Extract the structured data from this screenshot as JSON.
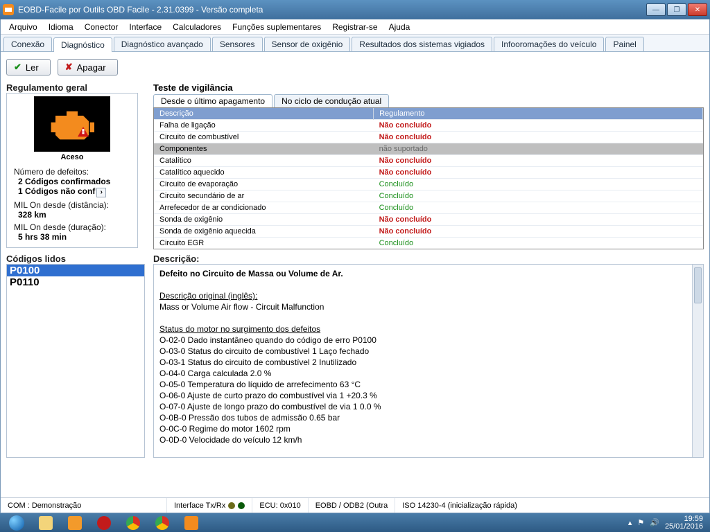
{
  "window": {
    "title": "EOBD-Facile por Outils OBD Facile - 2.31.0399 - Versão completa"
  },
  "menu": {
    "items": [
      "Arquivo",
      "Idioma",
      "Conector",
      "Interface",
      "Calculadores",
      "Funções suplementares",
      "Registrar-se",
      "Ajuda"
    ]
  },
  "tabs": {
    "items": [
      "Conexão",
      "Diagnóstico",
      "Diagnóstico avançado",
      "Sensores",
      "Sensor de oxigênio",
      "Resultados dos sistemas vigiados",
      "Infooromações do veículo",
      "Painel"
    ],
    "active": 1
  },
  "toolbar": {
    "read": "Ler",
    "erase": "Apagar"
  },
  "left": {
    "title": "Regulamento geral",
    "engine_state": "Aceso",
    "defects_label": "Número de defeitos:",
    "confirmed": "2 Códigos confirmados",
    "unconfirmed": "1 Códigos não conf",
    "mil_dist_label": "MIL On desde (distância):",
    "mil_dist": "328 km",
    "mil_dur_label": "MIL On desde (duração):",
    "mil_dur": "5 hrs 38 min"
  },
  "vigil": {
    "title": "Teste de vigilância",
    "tabs": [
      "Desde o último apagamento",
      "No ciclo de condução atual"
    ],
    "active_tab": 0,
    "headers": [
      "Descrição",
      "Regulamento"
    ],
    "rows": [
      {
        "d": "Falha de ligação",
        "s": "Não concluído",
        "c": "red"
      },
      {
        "d": "Circuito de combustível",
        "s": "Não concluído",
        "c": "red"
      },
      {
        "d": "Componentes",
        "s": "não suportado",
        "c": "grey",
        "sel": true
      },
      {
        "d": "Catalítico",
        "s": "Não concluído",
        "c": "red"
      },
      {
        "d": "Catalítico aquecido",
        "s": "Não concluído",
        "c": "red"
      },
      {
        "d": "Circuito de evaporação",
        "s": "Concluído",
        "c": "green"
      },
      {
        "d": "Circuito secundário de ar",
        "s": "Concluído",
        "c": "green"
      },
      {
        "d": "Arrefecedor de ar condicionado",
        "s": "Concluído",
        "c": "green"
      },
      {
        "d": "Sonda de oxigênio",
        "s": "Não concluído",
        "c": "red"
      },
      {
        "d": "Sonda de oxigênio aquecida",
        "s": "Não concluído",
        "c": "red"
      },
      {
        "d": "Circuito EGR",
        "s": "Concluído",
        "c": "green"
      }
    ]
  },
  "codes": {
    "title": "Códigos lidos",
    "items": [
      "P0100",
      "P0110"
    ],
    "selected": 0
  },
  "desc": {
    "title": "Descrição:",
    "headline": "Defeito no Circuito de Massa ou Volume de Ar.",
    "orig_label": "Descrição original (inglês):",
    "orig_text": "Mass or Volume Air flow - Circuit Malfunction",
    "status_label": "Status do motor no surgimento dos defeitos",
    "lines": [
      "O-02-0  Dado instantâneo quando do código de erro      P0100",
      "O-03-0  Status do circuito de combustível 1     Laço fechado",
      "O-03-1  Status do circuito de combustível 2     Inutilizado",
      "O-04-0  Carga calculada     2.0 %",
      "O-05-0  Temperatura do líquido de arrefecimento     63 °C",
      "O-06-0  Ajuste de curto prazo do combustível via 1     +20.3 %",
      "O-07-0  Ajuste de longo prazo do combustível de via 1     0.0 %",
      "O-0B-0  Pressão dos tubos de admissão     0.65 bar",
      "O-0C-0  Regime do motor     1602 rpm",
      "O-0D-0  Velocidade do veículo     12 km/h"
    ]
  },
  "statusbar": {
    "com": "COM : Demonstração",
    "iface": "Interface Tx/Rx",
    "ecu": "ECU: 0x010",
    "proto1": "EOBD / ODB2 (Outra",
    "proto2": "ISO 14230-4 (inicialização rápida)"
  },
  "tray": {
    "time": "19:59",
    "date": "25/01/2016"
  }
}
